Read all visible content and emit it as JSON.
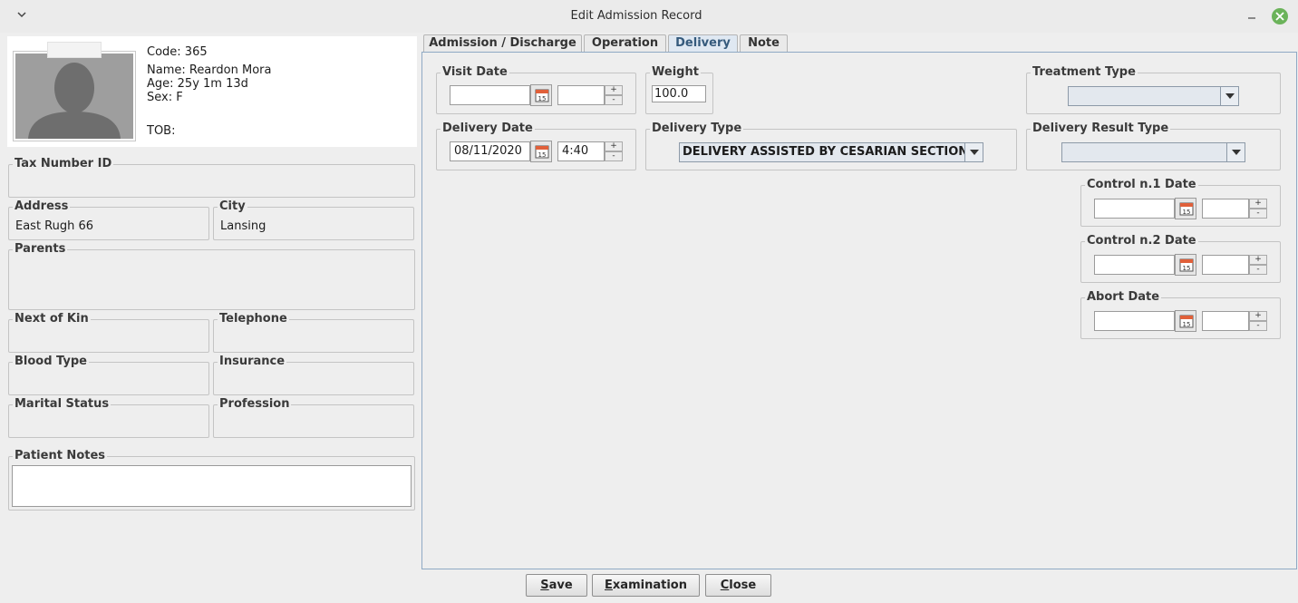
{
  "window": {
    "title": "Edit Admission Record"
  },
  "patient": {
    "code_line": "Code: 365",
    "name_line": "Name: Reardon Mora",
    "age_line": "Age: 25y 1m 13d",
    "sex_line": "Sex: F",
    "tob_line": "TOB:"
  },
  "fields": {
    "tax_number": {
      "label": "Tax Number ID",
      "value": ""
    },
    "address": {
      "label": "Address",
      "value": "East Rugh 66"
    },
    "city": {
      "label": "City",
      "value": "Lansing"
    },
    "parents": {
      "label": "Parents",
      "value": ""
    },
    "next_of_kin": {
      "label": "Next of Kin",
      "value": ""
    },
    "telephone": {
      "label": "Telephone",
      "value": ""
    },
    "blood_type": {
      "label": "Blood Type",
      "value": ""
    },
    "insurance": {
      "label": "Insurance",
      "value": ""
    },
    "marital_status": {
      "label": "Marital Status",
      "value": ""
    },
    "profession": {
      "label": "Profession",
      "value": ""
    },
    "patient_notes": {
      "label": "Patient Notes",
      "value": ""
    }
  },
  "tabs": [
    {
      "label": "Admission / Discharge",
      "active": false
    },
    {
      "label": "Operation",
      "active": false
    },
    {
      "label": "Delivery",
      "active": true
    },
    {
      "label": "Note",
      "active": false
    }
  ],
  "delivery": {
    "visit_date": {
      "label": "Visit Date",
      "date": "",
      "time": ""
    },
    "weight": {
      "label": "Weight",
      "value": "100.0"
    },
    "treatment_type": {
      "label": "Treatment Type",
      "value": ""
    },
    "delivery_date": {
      "label": "Delivery Date",
      "date": "08/11/2020",
      "time": "4:40"
    },
    "delivery_type": {
      "label": "Delivery Type",
      "value": "DELIVERY ASSISTED BY CESARIAN SECTION"
    },
    "delivery_result_type": {
      "label": "Delivery Result Type",
      "value": ""
    },
    "control_1_date": {
      "label": "Control n.1 Date",
      "date": "",
      "time": ""
    },
    "control_2_date": {
      "label": "Control n.2 Date",
      "date": "",
      "time": ""
    },
    "abort_date": {
      "label": "Abort Date",
      "date": "",
      "time": ""
    },
    "calendar_day": "15",
    "spin_up": "+",
    "spin_down": "-"
  },
  "buttons": {
    "save": {
      "mnemonic": "S",
      "rest": "ave"
    },
    "examination": {
      "mnemonic": "E",
      "rest": "xamination"
    },
    "close": {
      "mnemonic": "C",
      "rest": "lose"
    }
  },
  "icons": {
    "window_menu": "chevron-down-icon",
    "minimize": "minimize-icon",
    "close": "close-icon",
    "calendar": "calendar-icon",
    "dropdown": "dropdown-arrow-icon",
    "photo": "person-silhouette-icon"
  },
  "colors": {
    "window_bg": "#eeeeee",
    "close_button": "#6bb35a",
    "active_tab_text": "#355a7c",
    "panel_border": "#8fa9c4"
  }
}
